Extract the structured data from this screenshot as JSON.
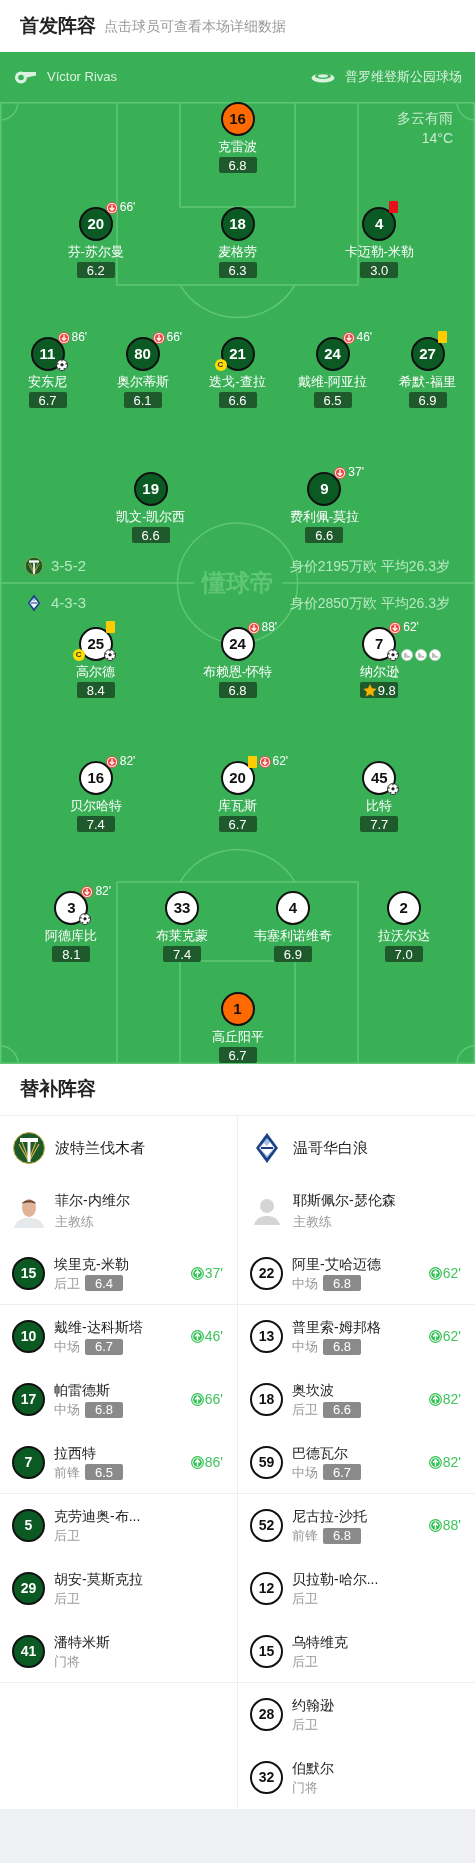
{
  "header": {
    "title": "首发阵容",
    "hint": "点击球员可查看本场详细数据"
  },
  "pitch": {
    "referee": "Víctor Rivas",
    "stadium": "普罗维登斯公园球场",
    "weather": "多云有雨",
    "temperature": "14°C",
    "brand": "懂球帝"
  },
  "home": {
    "formation": "3-5-2",
    "summary": "身价2195万欧 平均26.3岁",
    "goalkeeper": {
      "number": "16",
      "name": "克雷波",
      "rating": "6.8",
      "best": false
    },
    "lines": [
      [
        {
          "number": "20",
          "name": "芬-苏尔曼",
          "rating": "6.2",
          "best": false,
          "top": [
            {
              "kind": "sub_out",
              "minute": "66'"
            }
          ]
        },
        {
          "number": "18",
          "name": "麦格劳",
          "rating": "6.3",
          "best": false
        },
        {
          "number": "4",
          "name": "卡迈勒-米勒",
          "rating": "3.0",
          "best": false,
          "top": [
            {
              "kind": "red_card"
            }
          ]
        }
      ],
      [
        {
          "number": "11",
          "name": "安东尼",
          "rating": "6.7",
          "best": false,
          "top": [
            {
              "kind": "sub_out",
              "minute": "86'"
            }
          ],
          "bottom": [
            {
              "kind": "goal"
            }
          ]
        },
        {
          "number": "80",
          "name": "奥尔蒂斯",
          "rating": "6.1",
          "best": false,
          "top": [
            {
              "kind": "sub_out",
              "minute": "66'"
            }
          ]
        },
        {
          "number": "21",
          "name": "迭戈-查拉",
          "rating": "6.6",
          "captain_mark": "C",
          "best": false
        },
        {
          "number": "24",
          "name": "戴维-阿亚拉",
          "rating": "6.5",
          "best": false,
          "top": [
            {
              "kind": "sub_out",
              "minute": "46'"
            }
          ]
        },
        {
          "number": "27",
          "name": "希默-福里",
          "rating": "6.9",
          "best": false,
          "top": [
            {
              "kind": "yellow_card"
            }
          ]
        }
      ],
      [
        {
          "number": "19",
          "name": "凯文-凯尔西",
          "rating": "6.6",
          "best": false
        },
        {
          "number": "9",
          "name": "费利佩-莫拉",
          "rating": "6.6",
          "best": false,
          "top": [
            {
              "kind": "sub_out",
              "minute": "37'"
            }
          ]
        }
      ]
    ]
  },
  "away": {
    "formation": "4-3-3",
    "summary": "身价2850万欧 平均26.3岁",
    "lines": [
      [
        {
          "number": "25",
          "name": "高尔德",
          "rating": "8.4",
          "captain_mark": "C",
          "best": false,
          "top": [
            {
              "kind": "yellow_card"
            }
          ],
          "bottom": [
            {
              "kind": "goal"
            }
          ]
        },
        {
          "number": "24",
          "name": "布赖恩-怀特",
          "rating": "6.8",
          "best": false,
          "top": [
            {
              "kind": "sub_out",
              "minute": "88'"
            }
          ]
        },
        {
          "number": "7",
          "name": "纳尔逊",
          "rating": "9.8",
          "best": true,
          "top": [
            {
              "kind": "sub_out",
              "minute": "62'"
            }
          ],
          "bottom": [
            {
              "kind": "goal"
            },
            {
              "kind": "assist"
            },
            {
              "kind": "assist"
            },
            {
              "kind": "assist"
            }
          ]
        }
      ],
      [
        {
          "number": "16",
          "name": "贝尔哈特",
          "rating": "7.4",
          "best": false,
          "top": [
            {
              "kind": "sub_out",
              "minute": "82'"
            }
          ]
        },
        {
          "number": "20",
          "name": "库瓦斯",
          "rating": "6.7",
          "best": false,
          "top": [
            {
              "kind": "yellow_card"
            },
            {
              "kind": "sub_out",
              "minute": "62'"
            }
          ]
        },
        {
          "number": "45",
          "name": "比特",
          "rating": "7.7",
          "best": false,
          "bottom": [
            {
              "kind": "goal"
            }
          ]
        }
      ],
      [
        {
          "number": "3",
          "name": "阿德库比",
          "rating": "8.1",
          "best": false,
          "top": [
            {
              "kind": "sub_out",
              "minute": "82'"
            }
          ],
          "bottom": [
            {
              "kind": "goal"
            }
          ]
        },
        {
          "number": "33",
          "name": "布莱克蒙",
          "rating": "7.4",
          "best": false
        },
        {
          "number": "4",
          "name": "韦塞利诺维奇",
          "rating": "6.9",
          "best": false
        },
        {
          "number": "2",
          "name": "拉沃尔达",
          "rating": "7.0",
          "best": false
        }
      ]
    ],
    "goalkeeper": {
      "number": "1",
      "name": "高丘阳平",
      "rating": "6.7",
      "best": false
    }
  },
  "substitutes": {
    "title": "替补阵容",
    "teams": [
      {
        "name": "波特兰伐木者",
        "kind": "home",
        "coach": {
          "name": "菲尔-内维尔",
          "role": "主教练"
        },
        "players": [
          {
            "number": "15",
            "name": "埃里克-米勒",
            "position": "后卫",
            "rating": "6.4",
            "sub_in": "37'"
          },
          {
            "number": "10",
            "name": "戴维-达科斯塔",
            "position": "中场",
            "rating": "6.7",
            "sub_in": "46'"
          },
          {
            "number": "17",
            "name": "帕雷德斯",
            "position": "中场",
            "rating": "6.8",
            "sub_in": "66'"
          },
          {
            "number": "7",
            "name": "拉西特",
            "position": "前锋",
            "rating": "6.5",
            "sub_in": "86'"
          },
          {
            "number": "5",
            "name": "克劳迪奥-布...",
            "position": "后卫"
          },
          {
            "number": "29",
            "name": "胡安-莫斯克拉",
            "position": "后卫"
          },
          {
            "number": "41",
            "name": "潘特米斯",
            "position": "门将"
          }
        ]
      },
      {
        "name": "温哥华白浪",
        "kind": "away",
        "coach": {
          "name": "耶斯佩尔-瑟伦森",
          "role": "主教练",
          "kind": "placeholder"
        },
        "players": [
          {
            "number": "22",
            "name": "阿里-艾哈迈德",
            "position": "中场",
            "rating": "6.8",
            "sub_in": "62'"
          },
          {
            "number": "13",
            "name": "普里索-姆邦格",
            "position": "中场",
            "rating": "6.8",
            "sub_in": "62'"
          },
          {
            "number": "18",
            "name": "奥坎波",
            "position": "后卫",
            "rating": "6.6",
            "sub_in": "82'"
          },
          {
            "number": "59",
            "name": "巴德瓦尔",
            "position": "中场",
            "rating": "6.7",
            "sub_in": "82'"
          },
          {
            "number": "52",
            "name": "尼古拉-沙托",
            "position": "前锋",
            "rating": "6.8",
            "sub_in": "88'"
          },
          {
            "number": "12",
            "name": "贝拉勒-哈尔...",
            "position": "后卫"
          },
          {
            "number": "15",
            "name": "乌特维克",
            "position": "后卫"
          },
          {
            "number": "28",
            "name": "约翰逊",
            "position": "后卫"
          },
          {
            "number": "32",
            "name": "伯默尔",
            "position": "门将"
          }
        ]
      }
    ]
  }
}
